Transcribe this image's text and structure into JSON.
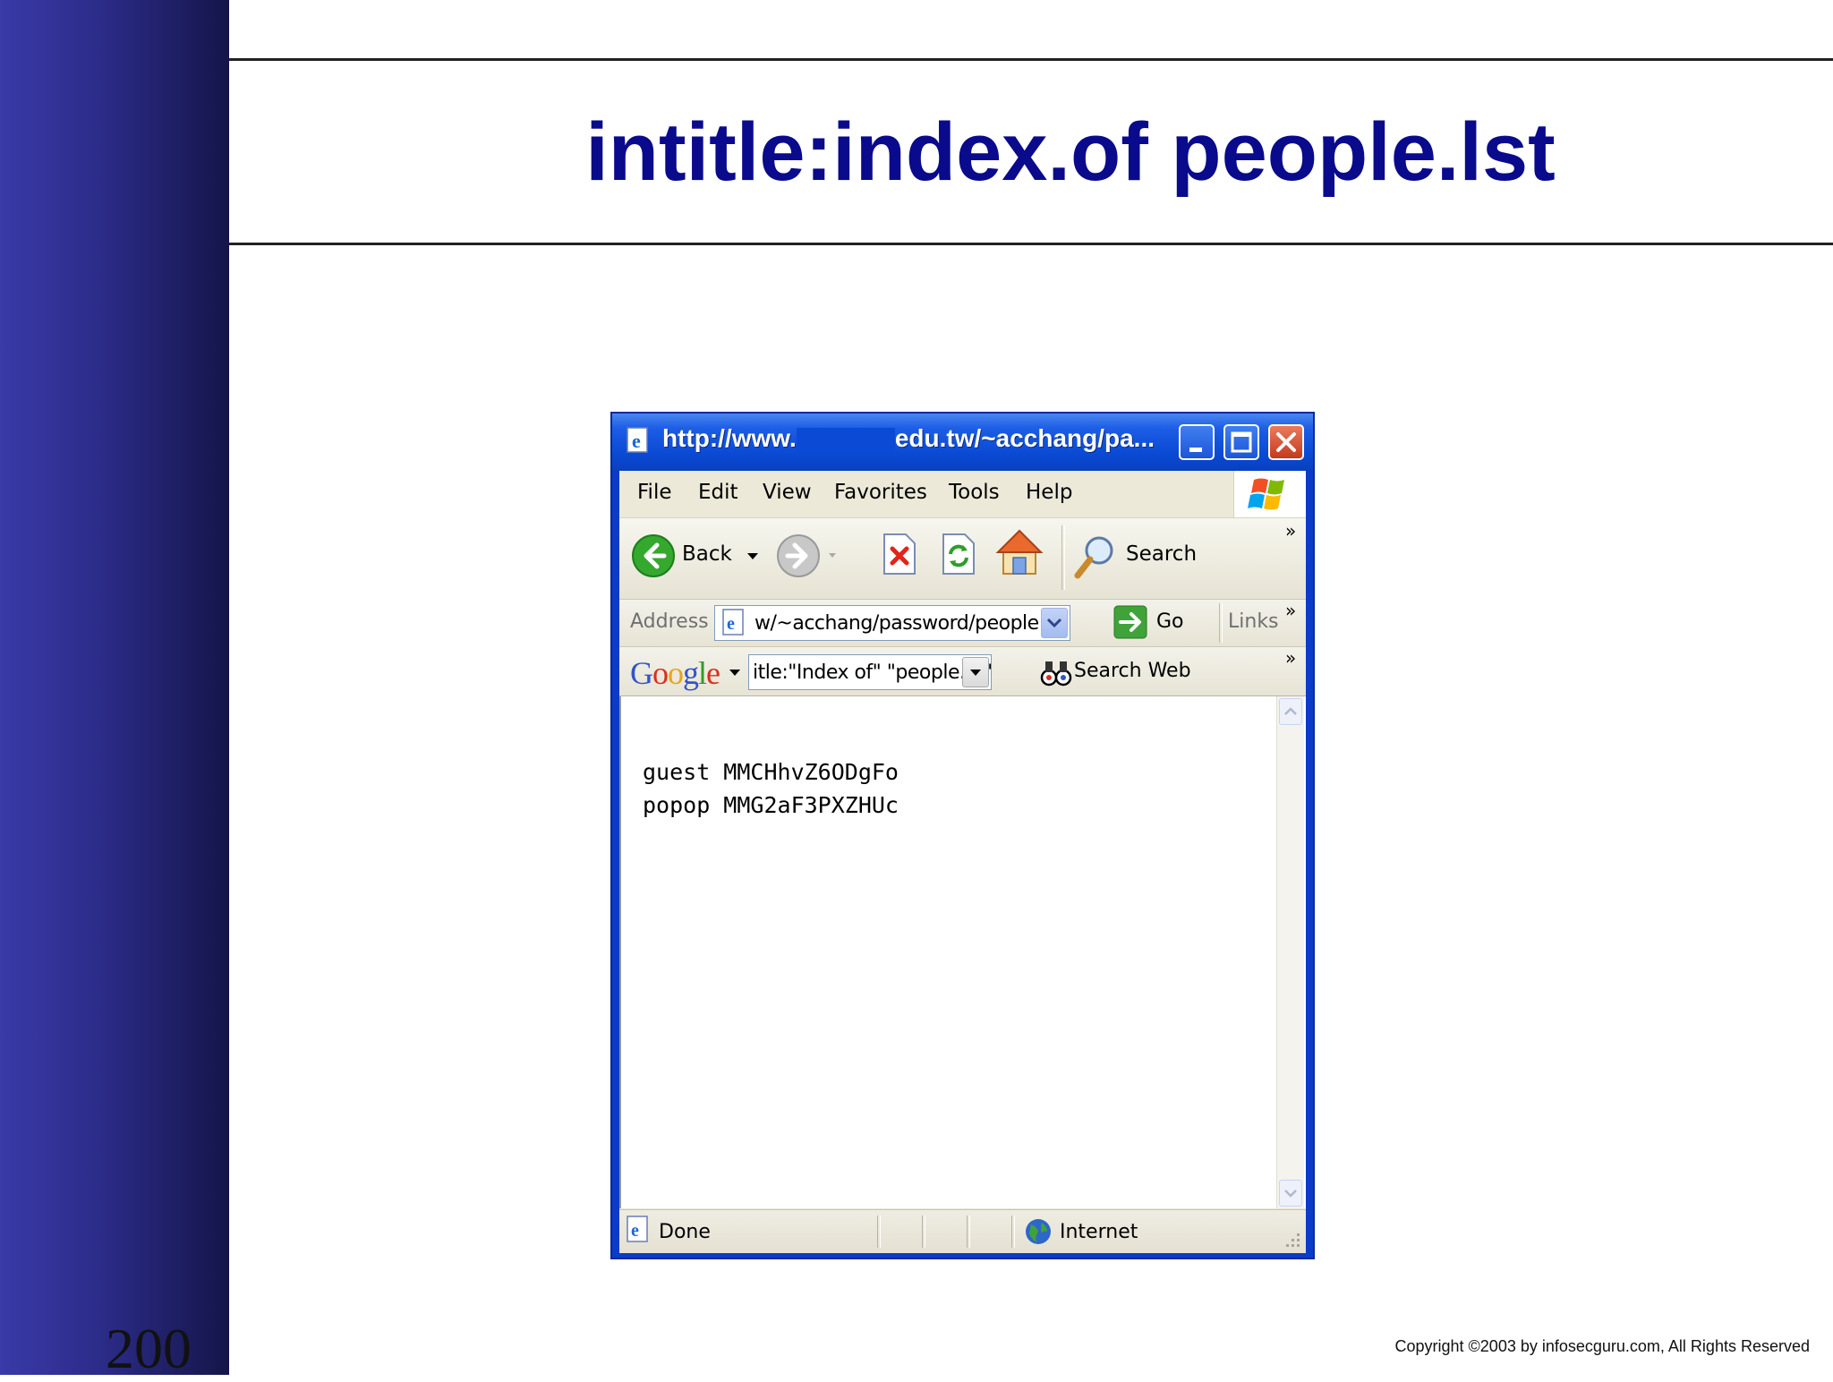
{
  "slide": {
    "title": "intitle:index.of people.lst",
    "number": "200",
    "copyright": "Copyright  ©2003 by infosecguru.com, All Rights Reserved"
  },
  "browser": {
    "title_prefix": "http://www.",
    "title_suffix": "edu.tw/~acchang/pa...",
    "menu": [
      "File",
      "Edit",
      "View",
      "Favorites",
      "Tools",
      "Help"
    ],
    "toolbar": {
      "back_label": "Back",
      "search_label": "Search",
      "more": "»"
    },
    "address": {
      "label": "Address",
      "value": "w/~acchang/password/people.lst",
      "go_label": "Go",
      "links_label": "Links",
      "more": "»"
    },
    "google": {
      "logo": "Google",
      "query": "itle:\"Index of\" \"people.lst\"",
      "search_web_label": "Search Web",
      "more": "»"
    },
    "content_lines": [
      "guest MMCHhvZ6ODgFo",
      "popop MMG2aF3PXZHUc"
    ],
    "status": {
      "done": "Done",
      "zone": "Internet"
    }
  },
  "colors": {
    "title_blue": "#0a0a8c",
    "sidebar_blue": "#2b2b88",
    "xp_title_blue": "#0a4ad4"
  }
}
